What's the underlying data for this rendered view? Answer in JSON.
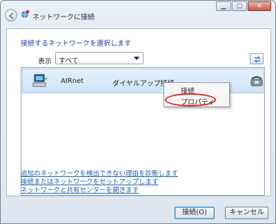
{
  "window": {
    "title": "ネットワークに接続",
    "caption_buttons": {
      "minimize": "▁",
      "maximize": "▢",
      "close": "✕"
    }
  },
  "instruction": "接続するネットワークを選択します",
  "filter": {
    "label": "表示",
    "selected": "すべて"
  },
  "networks": [
    {
      "name": "AIRnet",
      "type": "ダイヤルアップ接続",
      "icon": "dialup-computer-icon"
    }
  ],
  "context_menu": {
    "items": [
      "接続",
      "プロパティ"
    ],
    "highlighted": "プロパティ",
    "highlight_color": "#e0252a"
  },
  "links": [
    "追加のネットワークを検出できない理由を診断します",
    "接続またはネットワークをセットアップします",
    "ネットワークと共有センターを開きます"
  ],
  "buttons": {
    "connect": "接続(O)",
    "cancel": "キャンセル"
  },
  "colors": {
    "instruction": "#1f3f9e",
    "link": "#1a5fb4",
    "selection": "#cce4f7"
  }
}
